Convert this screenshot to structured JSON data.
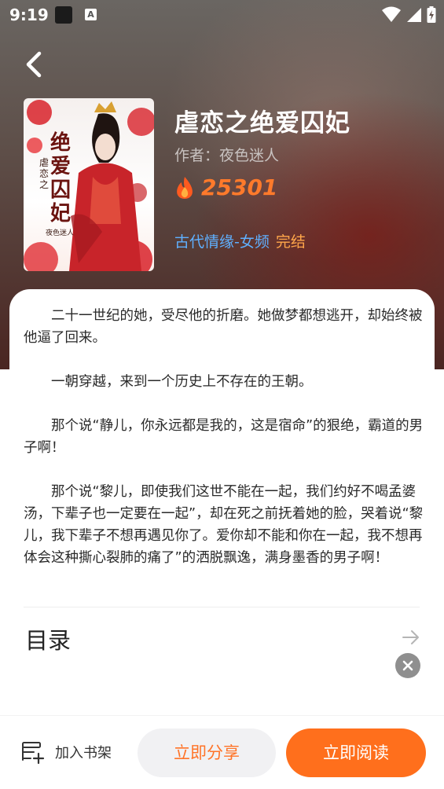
{
  "status_bar": {
    "time": "9:19",
    "notification_letter": "A",
    "icons": [
      "wifi-icon",
      "signal-icon",
      "battery-icon"
    ]
  },
  "book": {
    "title": "虐恋之绝爱囚妃",
    "author_label": "作者：",
    "author": "夜色迷人",
    "heat": "25301",
    "genre": "古代情缘-女频",
    "status": "完结",
    "cover": {
      "title_text": "绝爱囚妃",
      "series_text": "虐恋之",
      "author_text": "夜色迷人"
    }
  },
  "synopsis": {
    "paragraphs": [
      "二十一世纪的她，受尽他的折磨。她做梦都想逃开，却始终被他逼了回来。",
      "一朝穿越，来到一个历史上不存在的王朝。",
      "那个说“静儿，你永远都是我的，这是宿命”的狠绝，霸道的男子啊！",
      "那个说“黎儿，即使我们这世不能在一起，我们约好不喝孟婆汤，下辈子也一定要在一起”，却在死之前抚着她的脸，哭着说“黎儿，我下辈子不想再遇见你了。爱你却不能和你在一起，我不想再体会这种撕心裂肺的痛了”的洒脱飘逸，满身墨香的男子啊！"
    ]
  },
  "toc": {
    "label": "目录"
  },
  "bottom_bar": {
    "shelf_label": "加入书架",
    "share_label": "立即分享",
    "read_label": "立即阅读"
  },
  "colors": {
    "accent": "#ff6f1c",
    "heat": "#ff7a2b",
    "genre": "#5fb0ff",
    "status": "#ffa64a"
  }
}
